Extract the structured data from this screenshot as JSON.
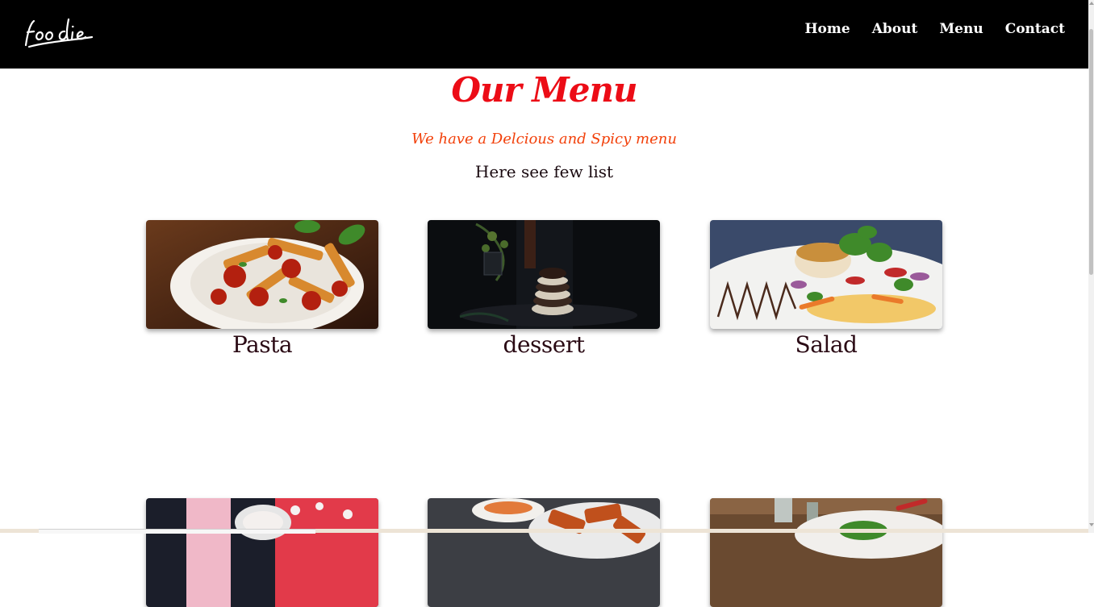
{
  "brand": {
    "logo_text": "foodie",
    "logo_color": "#ffffff"
  },
  "nav": {
    "items": [
      {
        "label": "Home"
      },
      {
        "label": "About"
      },
      {
        "label": "Menu"
      },
      {
        "label": "Contact"
      }
    ],
    "background": "#000000"
  },
  "menu_section": {
    "title": "Our Menu",
    "title_color": "#ec0c16",
    "tagline": "We have a Delcious and Spicy menu",
    "tagline_color": "#f2400a",
    "subtag": "Here see few list"
  },
  "cards": [
    {
      "label": "Pasta",
      "image": "pasta-photo"
    },
    {
      "label": "dessert",
      "image": "dessert-photo"
    },
    {
      "label": "Salad",
      "image": "salad-photo"
    },
    {
      "label": "",
      "image": "pink-drink-photo"
    },
    {
      "label": "",
      "image": "tandoori-photo"
    },
    {
      "label": "",
      "image": "dish-photo"
    }
  ]
}
